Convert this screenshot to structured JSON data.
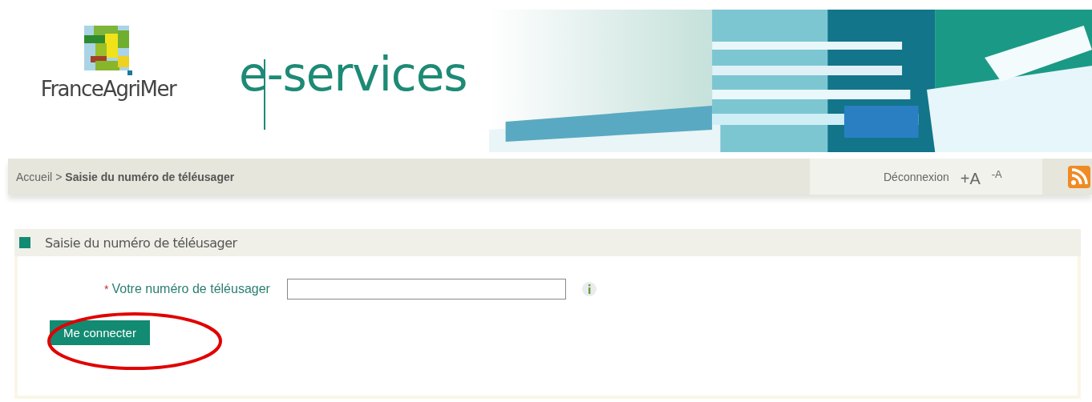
{
  "header": {
    "logo_text": "FranceAgriMer",
    "service_title": "e-services"
  },
  "breadcrumb": {
    "items": [
      {
        "label": "Accueil",
        "current": false
      },
      {
        "label": "Saisie du numéro de téléusager",
        "current": true
      }
    ],
    "separator": ">"
  },
  "toolbar": {
    "logout": "Déconnexion",
    "font_increase": "+A",
    "font_decrease": "-A"
  },
  "panel": {
    "title": "Saisie du numéro de téléusager",
    "field": {
      "required_mark": "*",
      "label": "Votre numéro de téléusager"
    },
    "submit": "Me connecter",
    "annotation": {
      "kind": "ellipse"
    }
  }
}
